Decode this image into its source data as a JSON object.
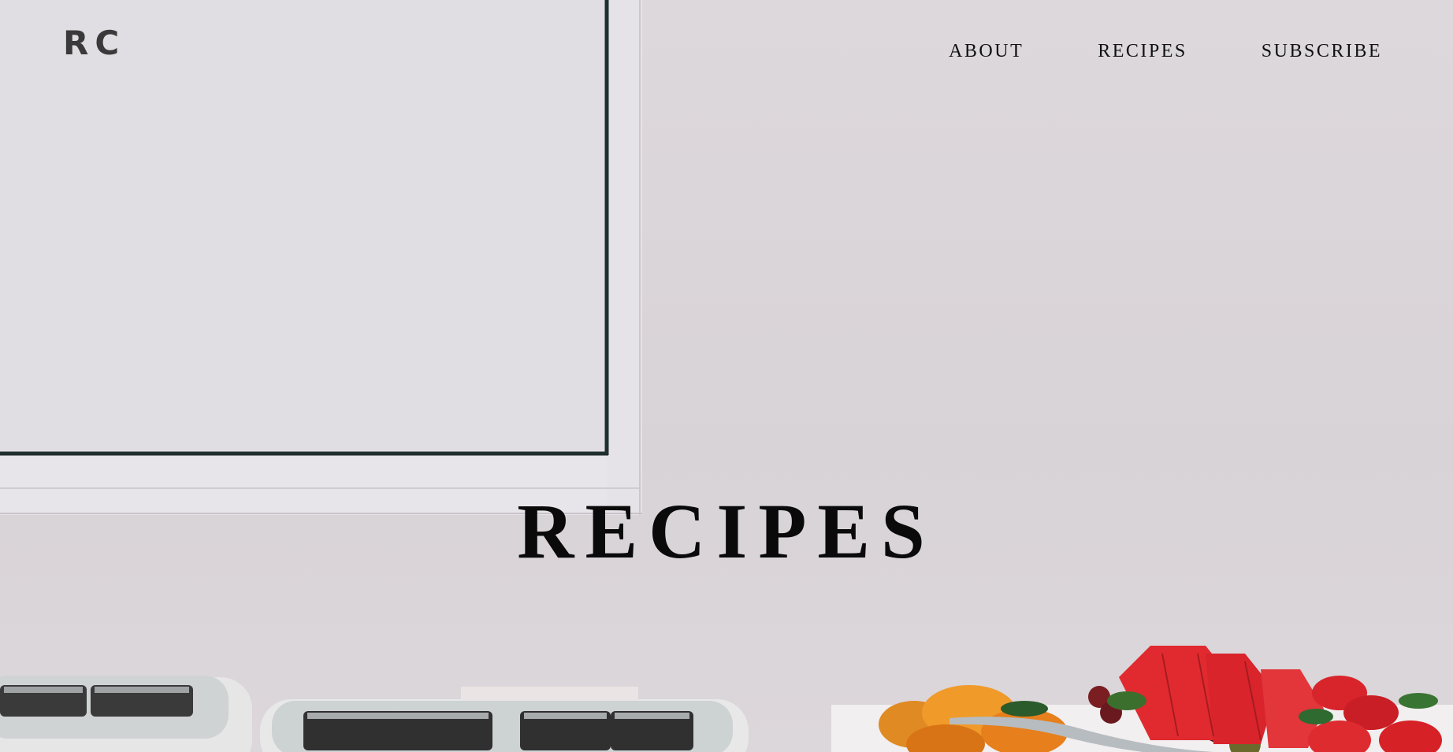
{
  "header": {
    "logo": "RC",
    "nav": [
      {
        "label": "ABOUT"
      },
      {
        "label": "RECIPES"
      },
      {
        "label": "SUBSCRIBE"
      }
    ]
  },
  "hero": {
    "title": "RECIPES",
    "colors": {
      "background": "#d9d4d8",
      "text": "#0a0a0a",
      "logo": "#3b3a3b"
    }
  }
}
